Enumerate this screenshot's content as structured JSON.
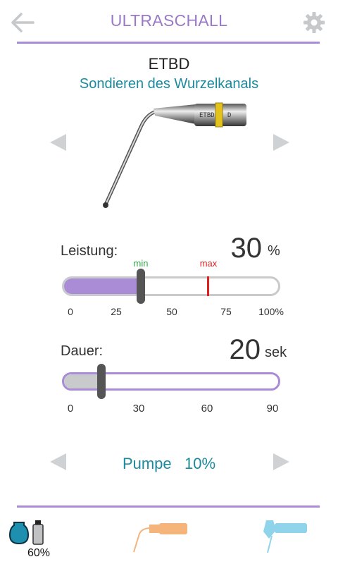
{
  "header": {
    "title": "ULTRASCHALL",
    "back_icon": "arrow-left-icon",
    "settings_icon": "gear-icon"
  },
  "tip": {
    "name": "ETBD",
    "description": "Sondieren des Wurzelkanals",
    "engraving": "ETBD"
  },
  "power": {
    "label": "Leistung:",
    "value": "30",
    "unit": "%",
    "level_percent": 30,
    "min_label": "min",
    "max_label": "max",
    "min_percent": 30,
    "max_percent": 75,
    "ticks": [
      "0",
      "25",
      "50",
      "75",
      "100%"
    ]
  },
  "duration": {
    "label": "Dauer:",
    "value": "20",
    "unit": "sek",
    "level_seconds": 20,
    "range_max": 90,
    "ticks": [
      "0",
      "30",
      "60",
      "90"
    ]
  },
  "pump": {
    "label": "Pumpe",
    "value": "10%"
  },
  "footer": {
    "bottle_percent": "60%",
    "icons": [
      "water-bottle-icon",
      "ultrasonic-handpiece-icon",
      "turbine-handpiece-icon"
    ]
  },
  "colors": {
    "accent": "#a98bd6",
    "teal": "#1b8a9e",
    "arrow_gray": "#cfd2d4",
    "min_marker": "#2fa84a",
    "max_marker": "#e02020",
    "handpiece_orange": "#f5b47a",
    "handpiece_blue": "#8fd4ea"
  }
}
